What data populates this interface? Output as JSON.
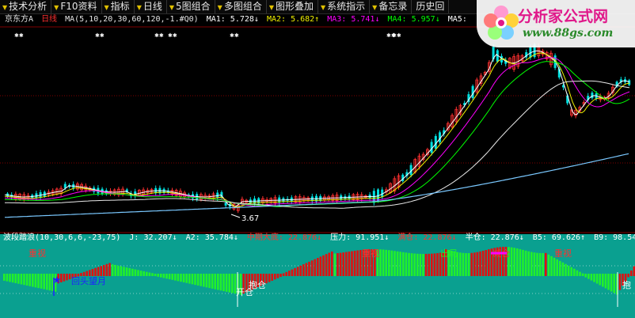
{
  "toolbar": [
    {
      "label": "技术分析",
      "arrow": "▼"
    },
    {
      "label": "F10资料",
      "arrow": "▼"
    },
    {
      "label": "指标",
      "arrow": "▼"
    },
    {
      "label": "日线",
      "arrow": "▼"
    },
    {
      "label": "5图组合",
      "arrow": "▼"
    },
    {
      "label": "多图组合",
      "arrow": "▼"
    },
    {
      "label": "图形叠加",
      "arrow": "▼"
    },
    {
      "label": "系统指示",
      "arrow": "▼"
    },
    {
      "label": "备忘录",
      "arrow": "▼"
    },
    {
      "label": "历史回",
      "arrow": ""
    }
  ],
  "main_title": {
    "stock": "京东方A",
    "period": "日线",
    "ma_params": "MA(5,10,20,30,60,120,-1.#Q0)",
    "ma1": "MA1: 5.728↓",
    "ma2": "MA2: 5.682↑",
    "ma3": "MA3: 5.741↓",
    "ma4": "MA4: 5.957↓",
    "ma5": "MA5: "
  },
  "low_label": "3.67",
  "sub_title": {
    "name": "波段踏浪(10,30,6,6,-23,75)",
    "j": "J: 32.207↓",
    "a2": "A2: 35.784↓",
    "bottom": "中期大底: 22.876↓",
    "pressure": "压力: 91.951↓",
    "full": "满仓: 22.876↓",
    "half": "半仓: 22.876↓",
    "b5": "B5: 69.626↑",
    "b9": "B9: 98.546↑"
  },
  "sub_labels": {
    "zhongshi1": "重视",
    "zhongshi2": "重视",
    "zhongshi3": "重视",
    "huitou": "回头望月",
    "kaicang": "开仓",
    "chuju": "出局",
    "jiancang": "减仓",
    "baocang": "抱仓",
    "right_cut": "抱"
  },
  "logo": {
    "text": "分析家公式网",
    "url": "www.88gs.com"
  },
  "colors": {
    "ma1": "#ffffff",
    "ma2": "#f0f000",
    "ma3": "#ff00ff",
    "ma4": "#00ff00",
    "ma5": "#ffffff",
    "up": "#ff3030",
    "down": "#00e0e0",
    "sub_bg": "#0aa090"
  }
}
